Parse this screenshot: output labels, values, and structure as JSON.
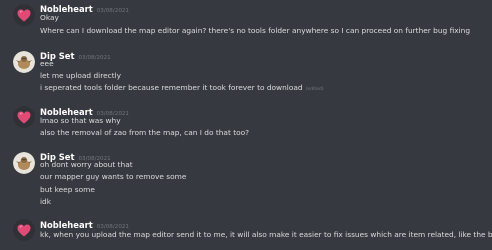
{
  "groups": [
    {
      "author": "Nobleheart",
      "timestamp": "03/08/2021",
      "author_color": "#ffffff",
      "avatar_icon": "pink-heart-avatar",
      "messages": [
        {
          "text": "Okay"
        },
        {
          "text": "Where can I download the map editor again? there's no tools folder anywhere so I can proceed on further bug fixing"
        }
      ]
    },
    {
      "author": "Dip Set",
      "timestamp": "03/08/2021",
      "author_color": "#ffffff",
      "avatar_icon": "bird-avatar",
      "messages": [
        {
          "text": "eee"
        },
        {
          "text": "let me upload directly"
        },
        {
          "text": "i seperated tools folder because remember it took forever to download",
          "edited": "(edited)"
        }
      ]
    },
    {
      "author": "Nobleheart",
      "timestamp": "03/08/2021",
      "author_color": "#ffffff",
      "avatar_icon": "pink-heart-avatar",
      "messages": [
        {
          "text": "lmao so that was why"
        },
        {
          "text": "also the removal of zao from the map, can I do that too?"
        }
      ]
    },
    {
      "author": "Dip Set",
      "timestamp": "03/08/2021",
      "author_color": "#ffffff",
      "avatar_icon": "bird-avatar",
      "messages": [
        {
          "text": "oh dont worry about that"
        },
        {
          "text": "our mapper guy wants to remove some"
        },
        {
          "text": "but keep some"
        },
        {
          "text": "idk"
        }
      ]
    },
    {
      "author": "Nobleheart",
      "timestamp": "03/08/2021",
      "author_color": "#ffffff",
      "avatar_icon": "pink-heart-avatar",
      "messages": [
        {
          "text": "kk, when you upload the map editor send it to me, it will also make it easier to fix issues which are item related, like the beds one"
        }
      ]
    }
  ],
  "colors": {
    "background": "#36393f",
    "text": "#dcddde",
    "muted": "#72767d",
    "heart": "#e04a74"
  }
}
